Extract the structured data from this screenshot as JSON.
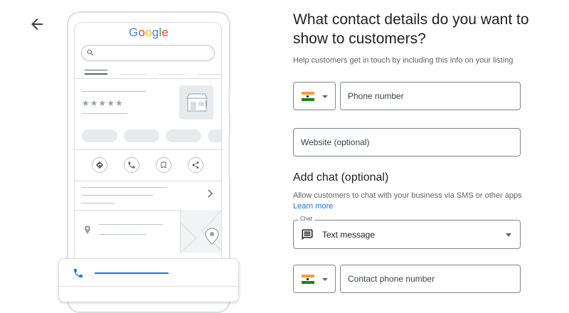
{
  "colors": {
    "accent": "#1a73e8",
    "border": "#80868b",
    "text": "#202124",
    "muted": "#5f6368"
  },
  "icons": {
    "back": "arrow-left-icon",
    "search": "search-icon",
    "store": "storefront-icon",
    "directions": "directions-icon",
    "call": "phone-icon",
    "save": "bookmark-icon",
    "share": "share-icon",
    "chevron": "chevron-right-icon",
    "location": "location-pin-icon",
    "chat": "message-icon"
  },
  "preview": {
    "brand": [
      "G",
      "o",
      "o",
      "g",
      "l",
      "e"
    ],
    "brand_colors": [
      "#4285F4",
      "#EA4335",
      "#FBBC05",
      "#4285F4",
      "#34A853",
      "#EA4335"
    ],
    "rating_stars": "★★★★★"
  },
  "form": {
    "heading": "What contact details do you want to show to customers?",
    "subheading": "Help customers get in touch by including this info on your listing",
    "phone": {
      "placeholder": "Phone number",
      "value": "",
      "country_flag": "India"
    },
    "website": {
      "placeholder": "Website (optional)",
      "value": ""
    },
    "chat_section": {
      "heading": "Add chat (optional)",
      "description": "Allow customers to chat with your business via SMS or other apps",
      "learn_more": "Learn more",
      "select_label": "Chat",
      "selected_option": "Text message",
      "contact_placeholder": "Contact phone number",
      "contact_value": ""
    }
  }
}
